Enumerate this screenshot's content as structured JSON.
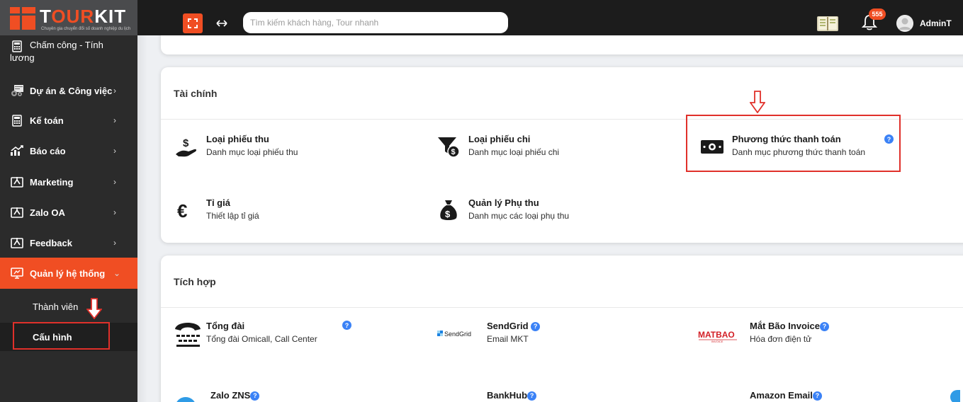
{
  "brand": {
    "name_part1": "T",
    "name_part2": "O",
    "name_part3": "UR",
    "name_part4": "KIT",
    "tagline": "Chuyên gia chuyển đổi số doanh nghiệp du lịch",
    "accent_color": "#f04e23"
  },
  "topbar": {
    "search_placeholder": "Tìm kiếm khách hàng, Tour nhanh",
    "notification_count": "555",
    "username": "AdminT"
  },
  "sidebar": {
    "items": [
      {
        "label_line1": "Chấm công - Tính",
        "label_line2": "lương",
        "icon": "calculator-icon"
      },
      {
        "label": "Dự án & Công việc",
        "icon": "project-icon"
      },
      {
        "label": "Kế toán",
        "icon": "calculator-icon"
      },
      {
        "label": "Báo cáo",
        "icon": "chart-icon"
      },
      {
        "label": "Marketing",
        "icon": "marketing-icon"
      },
      {
        "label": "Zalo OA",
        "icon": "marketing-icon"
      },
      {
        "label": "Feedback",
        "icon": "marketing-icon"
      },
      {
        "label": "Quản lý hệ thống",
        "icon": "monitor-icon",
        "active": true
      }
    ],
    "sub_items": [
      {
        "label": "Thành viên"
      },
      {
        "label": "Cấu hình",
        "current": true
      }
    ]
  },
  "finance": {
    "title": "Tài chính",
    "entries": [
      {
        "title": "Loại phiếu thu",
        "desc": "Danh mục loại phiếu thu",
        "icon": "hand-dollar-icon"
      },
      {
        "title": "Loại phiếu chi",
        "desc": "Danh mục loại phiếu chi",
        "icon": "funnel-dollar-icon"
      },
      {
        "title": "Phương thức thanh toán",
        "desc": "Danh mục phương thức thanh toán",
        "icon": "money-bill-icon"
      },
      {
        "title": "Tỉ giá",
        "desc": "Thiết lập tỉ giá",
        "icon": "euro-icon"
      },
      {
        "title": "Quản lý Phụ thu",
        "desc": "Danh mục các loại phụ thu",
        "icon": "money-bag-icon"
      }
    ]
  },
  "integration": {
    "title": "Tích hợp",
    "entries": [
      {
        "title": "Tổng đài",
        "desc": "Tổng đài Omicall, Call Center",
        "icon": "phone-icon"
      },
      {
        "title": "SendGrid",
        "desc": "Email MKT",
        "icon": "sendgrid-logo"
      },
      {
        "title": "Mắt Bão Invoice",
        "desc": "Hóa đơn điện tử",
        "icon": "matbao-logo"
      },
      {
        "title": "Zalo ZNS",
        "icon": "zalo-icon"
      },
      {
        "title": "BankHub"
      },
      {
        "title": "Amazon Email"
      }
    ],
    "sendgrid_logo_text": "SendGrid",
    "matbao_logo_text": "MATBAO",
    "matbao_logo_sub": "INVOICE"
  },
  "help_glyph": "?"
}
